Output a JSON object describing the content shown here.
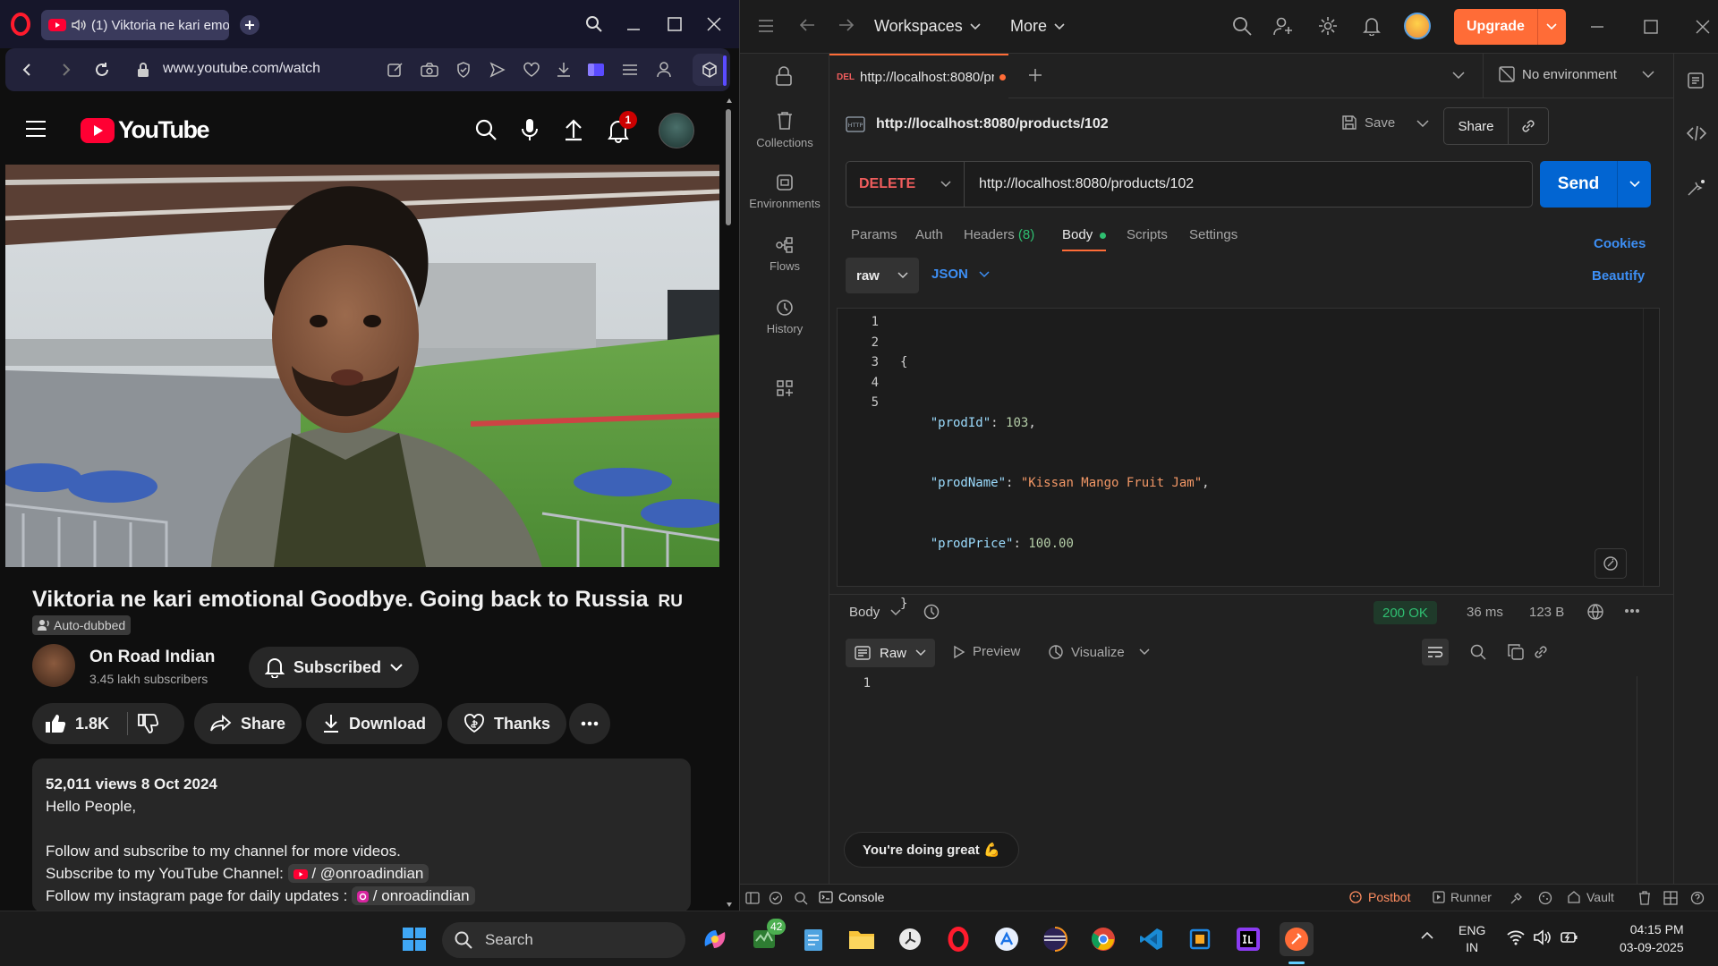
{
  "browser": {
    "tab_title": "(1) Viktoria ne kari emo",
    "url": "www.youtube.com/watch"
  },
  "youtube": {
    "logo_text": "YouTube",
    "notification_count": "1",
    "video_title": "Viktoria ne kari emotional Goodbye. Going back to Russia",
    "title_lang": "RU",
    "auto_dubbed": "Auto-dubbed",
    "channel_name": "On Road Indian",
    "subscribers": "3.45 lakh subscribers",
    "subscribed_label": "Subscribed",
    "likes": "1.8K",
    "share_label": "Share",
    "download_label": "Download",
    "thanks_label": "Thanks",
    "description": {
      "stats": "52,011 views  8 Oct 2024",
      "line1": "Hello People,",
      "line2": "Follow and subscribe to my channel for more videos.",
      "line3_prefix": "Subscribe to my YouTube Channel:",
      "line3_link": "/ @onroadindian",
      "line4_prefix": "Follow my instagram page for daily updates :",
      "line4_link": "/ onroadindian"
    }
  },
  "postman": {
    "top_nav": {
      "workspaces": "Workspaces",
      "more": "More",
      "upgrade": "Upgrade"
    },
    "tab": {
      "method_short": "DEL",
      "url": "http://localhost:8080/pr"
    },
    "environment": "No environment",
    "sidebar": [
      {
        "label": "Collections"
      },
      {
        "label": "Environments"
      },
      {
        "label": "Flows"
      },
      {
        "label": "History"
      }
    ],
    "request_name": "http://localhost:8080/products/102",
    "save_label": "Save",
    "share_label": "Share",
    "method": "DELETE",
    "url": "http://localhost:8080/products/102",
    "send_label": "Send",
    "req_tabs": {
      "params": "Params",
      "auth": "Auth",
      "headers": "Headers",
      "headers_count": "(8)",
      "body": "Body",
      "scripts": "Scripts",
      "settings": "Settings"
    },
    "cookies": "Cookies",
    "beautify": "Beautify",
    "body_mode": "raw",
    "body_lang": "JSON",
    "code_lines": [
      {
        "n": "1",
        "text": "{"
      },
      {
        "n": "2",
        "key": "\"prodId\"",
        "sep": ": ",
        "val": "103",
        "end": ","
      },
      {
        "n": "3",
        "key": "\"prodName\"",
        "sep": ": ",
        "val": "\"Kissan Mango Fruit Jam\"",
        "end": ","
      },
      {
        "n": "4",
        "key": "\"prodPrice\"",
        "sep": ": ",
        "val": "100.00",
        "end": ""
      },
      {
        "n": "5",
        "text": "}"
      }
    ],
    "response": {
      "label": "Body",
      "status": "200 OK",
      "time": "36 ms",
      "size": "123 B",
      "view_raw": "Raw",
      "view_preview": "Preview",
      "view_visualize": "Visualize",
      "line_number": "1"
    },
    "toast": "You're doing great 💪",
    "statusbar": {
      "console": "Console",
      "postbot": "Postbot",
      "runner": "Runner",
      "vault": "Vault"
    }
  },
  "taskbar": {
    "search_placeholder": "Search",
    "badge": "42",
    "lang_top": "ENG",
    "lang_bottom": "IN",
    "time": "04:15 PM",
    "date": "03-09-2025"
  },
  "colors": {
    "postman_orange": "#ff6c37",
    "send_blue": "#0265d2",
    "delete_red": "#f05d5d",
    "ok_green": "#2fbf71",
    "json_string": "#f29766",
    "json_key": "#9cdcfe",
    "youtube_red": "#ff0033"
  }
}
